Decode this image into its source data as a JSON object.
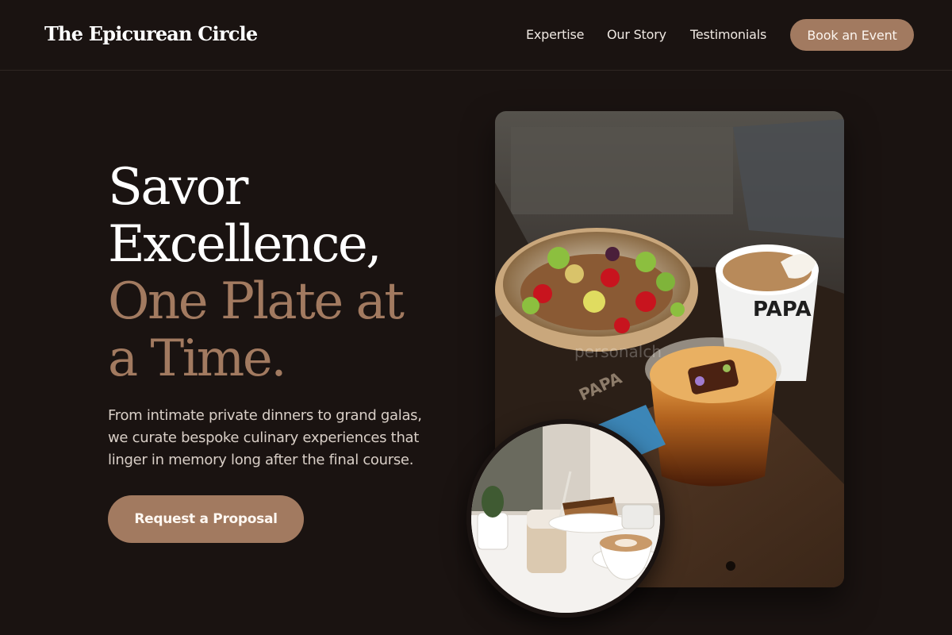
{
  "header": {
    "logo": "The Epicurean Circle",
    "nav": [
      {
        "label": "Expertise"
      },
      {
        "label": "Our Story"
      },
      {
        "label": "Testimonials"
      }
    ],
    "cta_label": "Book an Event"
  },
  "hero": {
    "title_lines": [
      "Savor",
      "Excellence,"
    ],
    "title_accent_lines": [
      "One Plate at",
      "a Time."
    ],
    "description_lines": [
      "From intimate private dinners to grand galas,",
      "we curate bespoke culinary experiences that",
      "linger in memory long after the final course."
    ],
    "cta_label": "Request a Proposal"
  },
  "images": {
    "main_photo_cup_text": "PAPA",
    "main_photo_watermark": "personalch",
    "main_photo_tray_text": "PAPA"
  },
  "colors": {
    "background": "#1a1311",
    "accent": "#a27a60",
    "text": "#ffffff"
  }
}
